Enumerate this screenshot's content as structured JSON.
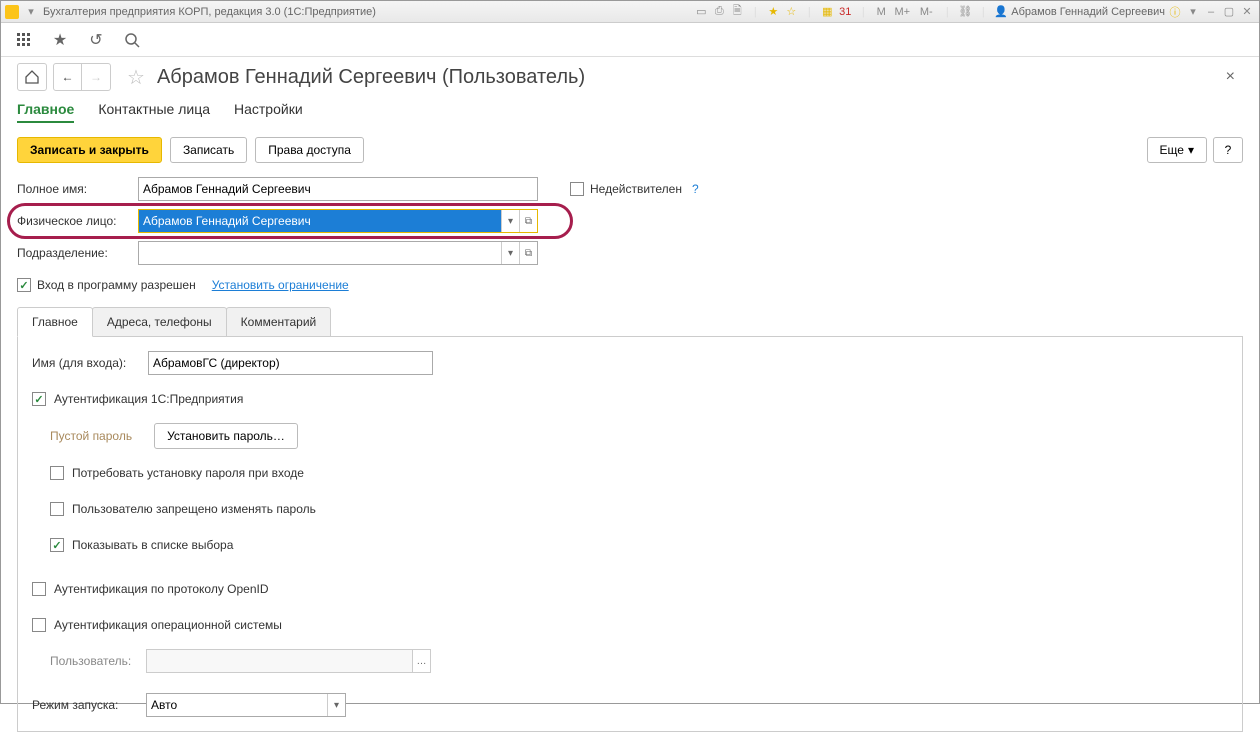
{
  "titlebar": {
    "title": "Бухгалтерия предприятия КОРП, редакция 3.0  (1С:Предприятие)",
    "user": "Абрамов Геннадий Сергеевич",
    "m_label": "M",
    "m_plus": "M+",
    "m_minus": "M-"
  },
  "page": {
    "title": "Абрамов Геннадий Сергеевич (Пользователь)"
  },
  "topTabs": {
    "main": "Главное",
    "contacts": "Контактные лица",
    "settings": "Настройки"
  },
  "actions": {
    "saveClose": "Записать и закрыть",
    "save": "Записать",
    "rights": "Права доступа",
    "more": "Еще",
    "help": "?"
  },
  "fields": {
    "fullNameLabel": "Полное имя:",
    "fullNameValue": "Абрамов Геннадий Сергеевич",
    "invalidLabel": "Недействителен",
    "individualLabel": "Физическое лицо:",
    "individualValue": "Абрамов Геннадий Сергеевич",
    "departmentLabel": "Подразделение:",
    "departmentValue": "",
    "loginAllowedLabel": "Вход в программу разрешен",
    "setRestrictionLink": "Установить ограничение"
  },
  "innerTabs": {
    "main": "Главное",
    "addresses": "Адреса, телефоны",
    "comment": "Комментарий"
  },
  "panel": {
    "loginNameLabel": "Имя (для входа):",
    "loginNameValue": "АбрамовГС (директор)",
    "auth1cLabel": "Аутентификация 1С:Предприятия",
    "emptyPassword": "Пустой пароль",
    "setPasswordBtn": "Установить пароль…",
    "requirePwChange": "Потребовать установку пароля при входе",
    "forbidPwChange": "Пользователю запрещено изменять пароль",
    "showInList": "Показывать в списке выбора",
    "authOpenId": "Аутентификация по протоколу OpenID",
    "authOs": "Аутентификация операционной системы",
    "osUserLabel": "Пользователь:",
    "osUserValue": "",
    "runModeLabel": "Режим запуска:",
    "runModeValue": "Авто"
  }
}
